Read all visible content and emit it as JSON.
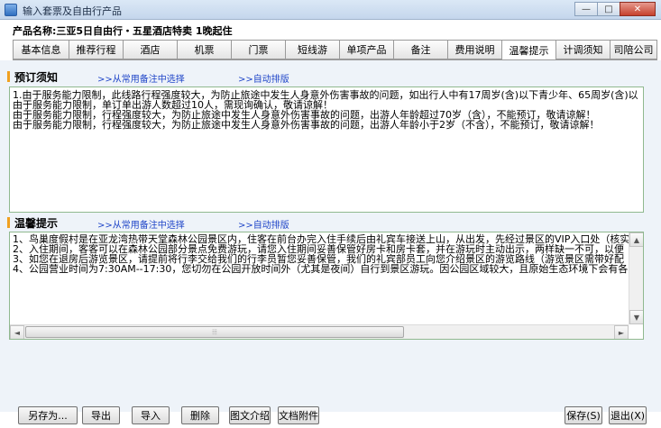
{
  "window": {
    "title": "输入套票及自由行产品",
    "minimize_glyph": "—",
    "maximize_glyph": "□",
    "close_glyph": "✕"
  },
  "product_name": "产品名称:三亚5日自由行・五星酒店特卖  1晚起住",
  "tabs": [
    "基本信息",
    "推荐行程",
    "酒店",
    "机票",
    "门票",
    "短线游",
    "单项产品",
    "备注",
    "费用说明",
    "温馨提示",
    "计调须知",
    "司陪公司"
  ],
  "active_tab": "温馨提示",
  "booking_notice": {
    "title": "预订须知",
    "link_select": ">>从常用备注中选择",
    "link_format": ">>自动排版",
    "lines": [
      "1.由于服务能力限制，此线路行程强度较大，为防止旅途中发生人身意外伤害事故的问题，如出行人中有17周岁(含)以下青少年、65周岁(含)以",
      "由于服务能力限制，单订单出游人数超过10人，需现询确认，敬请谅解！",
      "由于服务能力限制，行程强度较大，为防止旅途中发生人身意外伤害事故的问题，出游人年龄超过70岁（含），不能预订，敬请谅解！",
      "由于服务能力限制，行程强度较大，为防止旅途中发生人身意外伤害事故的问题，出游人年龄小于2岁（不含），不能预订，敬请谅解！"
    ]
  },
  "warm_tips": {
    "title": "温馨提示",
    "link_select": ">>从常用备注中选择",
    "link_format": ">>自动排版",
    "lines": [
      "1、鸟巢度假村是在亚龙湾热带天堂森林公园景区内，住客在前台办完入住手续后由礼宾车接送上山，从出发，先经过景区的VIP入口处（核实",
      "2、入住期间，客客可以在森林公园部分景点免费游玩，请您入住期间妥善保管好房卡和房卡套，并在游玩时主动出示，两样缺一不可，以便",
      "3、如您在退房后游览景区，请提前将行李交给我们的行李员暂您妥善保管，我们的礼宾部员工向您介绍景区的游览路线（游览景区需带好配",
      "4、公园营业时间为7:30AM--17:30，您切勿在公园开放时间外（尤其是夜间）自行到景区游玩。因公园区域较大，且原始生态环境下会有各类"
    ]
  },
  "buttons": {
    "save_as": "另存为...",
    "export": "导出",
    "import": "导入",
    "delete": "删除",
    "image_intro": "图文介绍",
    "doc_attach": "文档附件",
    "save": "保存(S)",
    "exit": "退出(X)"
  },
  "scroll": {
    "up_glyph": "▲",
    "down_glyph": "▼",
    "left_glyph": "◄",
    "right_glyph": "►",
    "grip_glyph": "⦙⦙⦙"
  }
}
